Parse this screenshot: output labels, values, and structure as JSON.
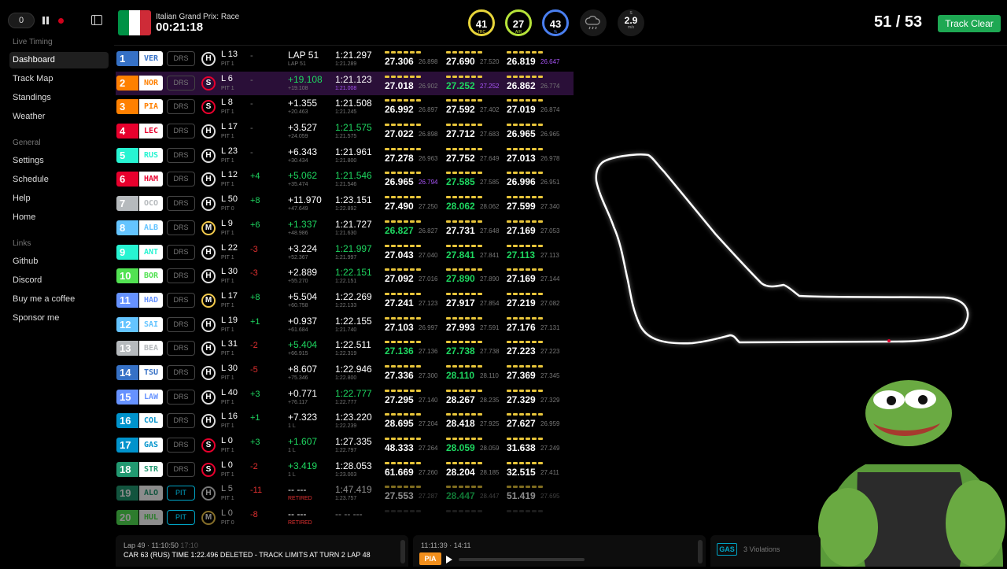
{
  "controls": {
    "speed": "0"
  },
  "sidebar": {
    "sections": [
      {
        "title": "Live Timing",
        "items": [
          "Dashboard",
          "Track Map",
          "Standings",
          "Weather"
        ]
      },
      {
        "title": "General",
        "items": [
          "Settings",
          "Schedule",
          "Help",
          "Home"
        ]
      },
      {
        "title": "Links",
        "items": [
          "Github",
          "Discord",
          "Buy me a coffee",
          "Sponsor me"
        ]
      }
    ],
    "active": "Dashboard"
  },
  "header": {
    "race_title": "Italian Grand Prix: Race",
    "timer": "00:21:18",
    "gauges": [
      {
        "value": "41",
        "label": "TRC",
        "color": "#e8d53a"
      },
      {
        "value": "27",
        "label": "AIR",
        "color": "#b6e33a"
      },
      {
        "value": "43",
        "label": "%",
        "color": "#4a7ff0"
      }
    ],
    "wind": {
      "dir": "S",
      "value": "2.9",
      "unit": "m/s"
    },
    "laps": "51 / 53",
    "track_status": "Track Clear",
    "track_status_color": "#1ea853"
  },
  "drivers": [
    {
      "pos": "1",
      "code": "VER",
      "color": "#3671c6",
      "drs": "DRS",
      "tyre": "H",
      "laps": "L 13",
      "pit": "PIT 1",
      "gained": "-",
      "gap": "LAP 51",
      "gap_sub": "LAP 51",
      "lap": "1:21.297",
      "lap_sub": "1:21.289",
      "s1": "27.306",
      "s1b": "26.898",
      "s2": "27.690",
      "s2b": "27.520",
      "s3": "26.819",
      "s3b": "26.647",
      "s3bc": "p"
    },
    {
      "pos": "2",
      "code": "NOR",
      "color": "#ff8000",
      "drs": "DRS",
      "tyre": "S",
      "laps": "L 6",
      "pit": "PIT 1",
      "gained": "-",
      "gap": "+19.108",
      "gap_sub": "+19.108",
      "gapc": "g",
      "lap": "1:21.123",
      "lap_sub": "1:21.008",
      "lapsubc": "p",
      "s1": "27.018",
      "s1b": "26.902",
      "s2": "27.252",
      "s2b": "27.252",
      "s2c": "g",
      "s2bc": "p",
      "s3": "26.862",
      "s3b": "26.774",
      "hl": true
    },
    {
      "pos": "3",
      "code": "PIA",
      "color": "#ff8000",
      "drs": "DRS",
      "tyre": "S",
      "laps": "L 8",
      "pit": "PIT 1",
      "gained": "-",
      "gap": "+1.355",
      "gap_sub": "+20.463",
      "lap": "1:21.508",
      "lap_sub": "1:21.245",
      "s1": "26.992",
      "s1b": "26.897",
      "s2": "27.592",
      "s2b": "27.402",
      "s3": "27.019",
      "s3b": "26.874"
    },
    {
      "pos": "4",
      "code": "LEC",
      "color": "#e8002d",
      "drs": "DRS",
      "tyre": "H",
      "laps": "L 17",
      "pit": "PIT 1",
      "gained": "-",
      "gap": "+3.527",
      "gap_sub": "+24.059",
      "lap": "1:21.575",
      "lap_sub": "1:21.575",
      "lapc": "g",
      "s1": "27.022",
      "s1b": "26.898",
      "s2": "27.712",
      "s2b": "27.683",
      "s3": "26.965",
      "s3b": "26.965"
    },
    {
      "pos": "5",
      "code": "RUS",
      "color": "#27f4d2",
      "drs": "DRS",
      "tyre": "H",
      "laps": "L 23",
      "pit": "PIT 1",
      "gained": "-",
      "gap": "+6.343",
      "gap_sub": "+30.434",
      "lap": "1:21.961",
      "lap_sub": "1:21.800",
      "s1": "27.278",
      "s1b": "26.963",
      "s2": "27.752",
      "s2b": "27.649",
      "s3": "27.013",
      "s3b": "26.978"
    },
    {
      "pos": "6",
      "code": "HAM",
      "color": "#e8002d",
      "drs": "DRS",
      "tyre": "H",
      "laps": "L 12",
      "pit": "PIT 1",
      "gained": "+4",
      "gainedc": "g",
      "gap": "+5.062",
      "gap_sub": "+35.474",
      "gapc": "g",
      "lap": "1:21.546",
      "lap_sub": "1:21.546",
      "lapc": "g",
      "s1": "26.965",
      "s1b": "26.794",
      "s1bc": "p",
      "s2": "27.585",
      "s2b": "27.585",
      "s2c": "g",
      "s3": "26.996",
      "s3b": "26.951"
    },
    {
      "pos": "7",
      "code": "OCO",
      "color": "#b6babd",
      "drs": "DRS",
      "tyre": "H",
      "laps": "L 50",
      "pit": "PIT 0",
      "gained": "+8",
      "gainedc": "g",
      "gap": "+11.970",
      "gap_sub": "+47.649",
      "lap": "1:23.151",
      "lap_sub": "1:22.892",
      "s1": "27.490",
      "s1b": "27.250",
      "s2": "28.062",
      "s2b": "28.062",
      "s2c": "g",
      "s3": "27.599",
      "s3b": "27.340"
    },
    {
      "pos": "8",
      "code": "ALB",
      "color": "#64c4ff",
      "drs": "DRS",
      "tyre": "M",
      "laps": "L 9",
      "pit": "PIT 1",
      "gained": "+6",
      "gainedc": "g",
      "gap": "+1.337",
      "gap_sub": "+48.986",
      "gapc": "g",
      "lap": "1:21.727",
      "lap_sub": "1:21.630",
      "s1": "26.827",
      "s1b": "26.827",
      "s1c": "g",
      "s2": "27.731",
      "s2b": "27.648",
      "s3": "27.169",
      "s3b": "27.053"
    },
    {
      "pos": "9",
      "code": "ANT",
      "color": "#27f4d2",
      "drs": "DRS",
      "tyre": "H",
      "laps": "L 22",
      "pit": "PIT 1",
      "gained": "-3",
      "gainedc": "r",
      "gap": "+3.224",
      "gap_sub": "+52.367",
      "lap": "1:21.997",
      "lap_sub": "1:21.997",
      "lapc": "g",
      "s1": "27.043",
      "s1b": "27.040",
      "s2": "27.841",
      "s2b": "27.841",
      "s2c": "g",
      "s3": "27.113",
      "s3b": "27.113",
      "s3c": "g"
    },
    {
      "pos": "10",
      "code": "BOR",
      "color": "#52e252",
      "drs": "DRS",
      "tyre": "H",
      "laps": "L 30",
      "pit": "PIT 1",
      "gained": "-3",
      "gainedc": "r",
      "gap": "+2.889",
      "gap_sub": "+55.270",
      "lap": "1:22.151",
      "lap_sub": "1:22.151",
      "lapc": "g",
      "s1": "27.092",
      "s1b": "27.016",
      "s2": "27.890",
      "s2b": "27.890",
      "s2c": "g",
      "s3": "27.169",
      "s3b": "27.144"
    },
    {
      "pos": "11",
      "code": "HAD",
      "color": "#6692ff",
      "drs": "DRS",
      "tyre": "M",
      "laps": "L 17",
      "pit": "PIT 1",
      "gained": "+8",
      "gainedc": "g",
      "gap": "+5.504",
      "gap_sub": "+60.758",
      "lap": "1:22.269",
      "lap_sub": "1:22.133",
      "s1": "27.241",
      "s1b": "27.123",
      "s2": "27.917",
      "s2b": "27.854",
      "s3": "27.219",
      "s3b": "27.082"
    },
    {
      "pos": "12",
      "code": "SAI",
      "color": "#64c4ff",
      "drs": "DRS",
      "tyre": "H",
      "laps": "L 19",
      "pit": "PIT 1",
      "gained": "+1",
      "gainedc": "g",
      "gap": "+0.937",
      "gap_sub": "+61.684",
      "lap": "1:22.155",
      "lap_sub": "1:21.740",
      "s1": "27.103",
      "s1b": "26.997",
      "s2": "27.993",
      "s2b": "27.591",
      "s3": "27.176",
      "s3b": "27.131"
    },
    {
      "pos": "13",
      "code": "BEA",
      "color": "#b6babd",
      "drs": "DRS",
      "tyre": "H",
      "laps": "L 31",
      "pit": "PIT 1",
      "gained": "-2",
      "gainedc": "r",
      "gap": "+5.404",
      "gap_sub": "+66.915",
      "gapc": "g",
      "lap": "1:22.511",
      "lap_sub": "1:22.319",
      "s1": "27.136",
      "s1b": "27.136",
      "s1c": "g",
      "s2": "27.738",
      "s2b": "27.738",
      "s2c": "g",
      "s3": "27.223",
      "s3b": "27.223"
    },
    {
      "pos": "14",
      "code": "TSU",
      "color": "#3671c6",
      "drs": "DRS",
      "tyre": "H",
      "laps": "L 30",
      "pit": "PIT 1",
      "gained": "-5",
      "gainedc": "r",
      "gap": "+8.607",
      "gap_sub": "+75.346",
      "lap": "1:22.946",
      "lap_sub": "1:22.800",
      "s1": "27.336",
      "s1b": "27.300",
      "s2": "28.110",
      "s2b": "28.110",
      "s2c": "g",
      "s3": "27.369",
      "s3b": "27.345"
    },
    {
      "pos": "15",
      "code": "LAW",
      "color": "#6692ff",
      "drs": "DRS",
      "tyre": "H",
      "laps": "L 40",
      "pit": "PIT 1",
      "gained": "+3",
      "gainedc": "g",
      "gap": "+0.771",
      "gap_sub": "+76.117",
      "lap": "1:22.777",
      "lap_sub": "1:22.777",
      "lapc": "g",
      "s1": "27.295",
      "s1b": "27.140",
      "s2": "28.267",
      "s2b": "28.235",
      "s3": "27.329",
      "s3b": "27.329"
    },
    {
      "pos": "16",
      "code": "COL",
      "color": "#0093cc",
      "drs": "DRS",
      "tyre": "H",
      "laps": "L 16",
      "pit": "PIT 1",
      "gained": "+1",
      "gainedc": "g",
      "gap": "+7.323",
      "gap_sub": "1 L",
      "lap": "1:23.220",
      "lap_sub": "1:22.239",
      "s1": "28.695",
      "s1b": "27.204",
      "s2": "28.418",
      "s2b": "27.925",
      "s3": "27.627",
      "s3b": "26.959"
    },
    {
      "pos": "17",
      "code": "GAS",
      "color": "#0093cc",
      "drs": "DRS",
      "tyre": "S",
      "laps": "L 0",
      "pit": "PIT 1",
      "gained": "+3",
      "gainedc": "g",
      "gap": "+1.607",
      "gap_sub": "1 L",
      "gapc": "g",
      "lap": "1:27.335",
      "lap_sub": "1:22.797",
      "s1": "48.333",
      "s1b": "27.264",
      "s2": "28.059",
      "s2b": "28.059",
      "s2c": "g",
      "s3": "31.638",
      "s3b": "27.249"
    },
    {
      "pos": "18",
      "code": "STR",
      "color": "#229971",
      "drs": "DRS",
      "tyre": "S",
      "laps": "L 0",
      "pit": "PIT 1",
      "gained": "-2",
      "gainedc": "r",
      "gap": "+3.419",
      "gap_sub": "1 L",
      "gapc": "g",
      "lap": "1:28.053",
      "lap_sub": "1:23.003",
      "s1": "61.669",
      "s1b": "27.260",
      "s2": "28.204",
      "s2b": "28.185",
      "s3": "32.515",
      "s3b": "27.411"
    },
    {
      "pos": "19",
      "code": "ALO",
      "color": "#229971",
      "drs": "PIT",
      "tyre": "H",
      "laps": "L 5",
      "pit": "PIT 1",
      "gained": "-11",
      "gainedc": "r",
      "gap": "-- ---",
      "gap_sub": "RETIRED",
      "gapsubc": "r",
      "lap": "1:47.419",
      "lap_sub": "1:23.757",
      "s1": "27.553",
      "s1b": "27.287",
      "s2": "28.447",
      "s2b": "28.447",
      "s2c": "g",
      "s3": "51.419",
      "s3b": "27.695",
      "dim": true
    },
    {
      "pos": "20",
      "code": "HUL",
      "color": "#52e252",
      "drs": "PIT",
      "tyre": "M",
      "laps": "L 0",
      "pit": "PIT 0",
      "gained": "-8",
      "gainedc": "r",
      "gap": "-- ---",
      "gap_sub": "RETIRED",
      "gapsubc": "r",
      "lap": "-- -- ---",
      "lap_sub": "",
      "s1": "",
      "s1b": "",
      "s2": "",
      "s2b": "",
      "s3": "",
      "s3b": "",
      "dim": true
    }
  ],
  "footer": {
    "race_control": {
      "time": "Lap 49 · 11:10:50",
      "time_ref": "17:10",
      "message": "CAR 63 (RUS) TIME 1:22.496 DELETED - TRACK LIMITS AT TURN 2 LAP 48"
    },
    "team_radio": {
      "time": "11:11:39 · 14:11",
      "driver": "PIA",
      "progress_pct": 0
    },
    "violations": {
      "driver": "GAS",
      "text": "3 Violations"
    }
  }
}
